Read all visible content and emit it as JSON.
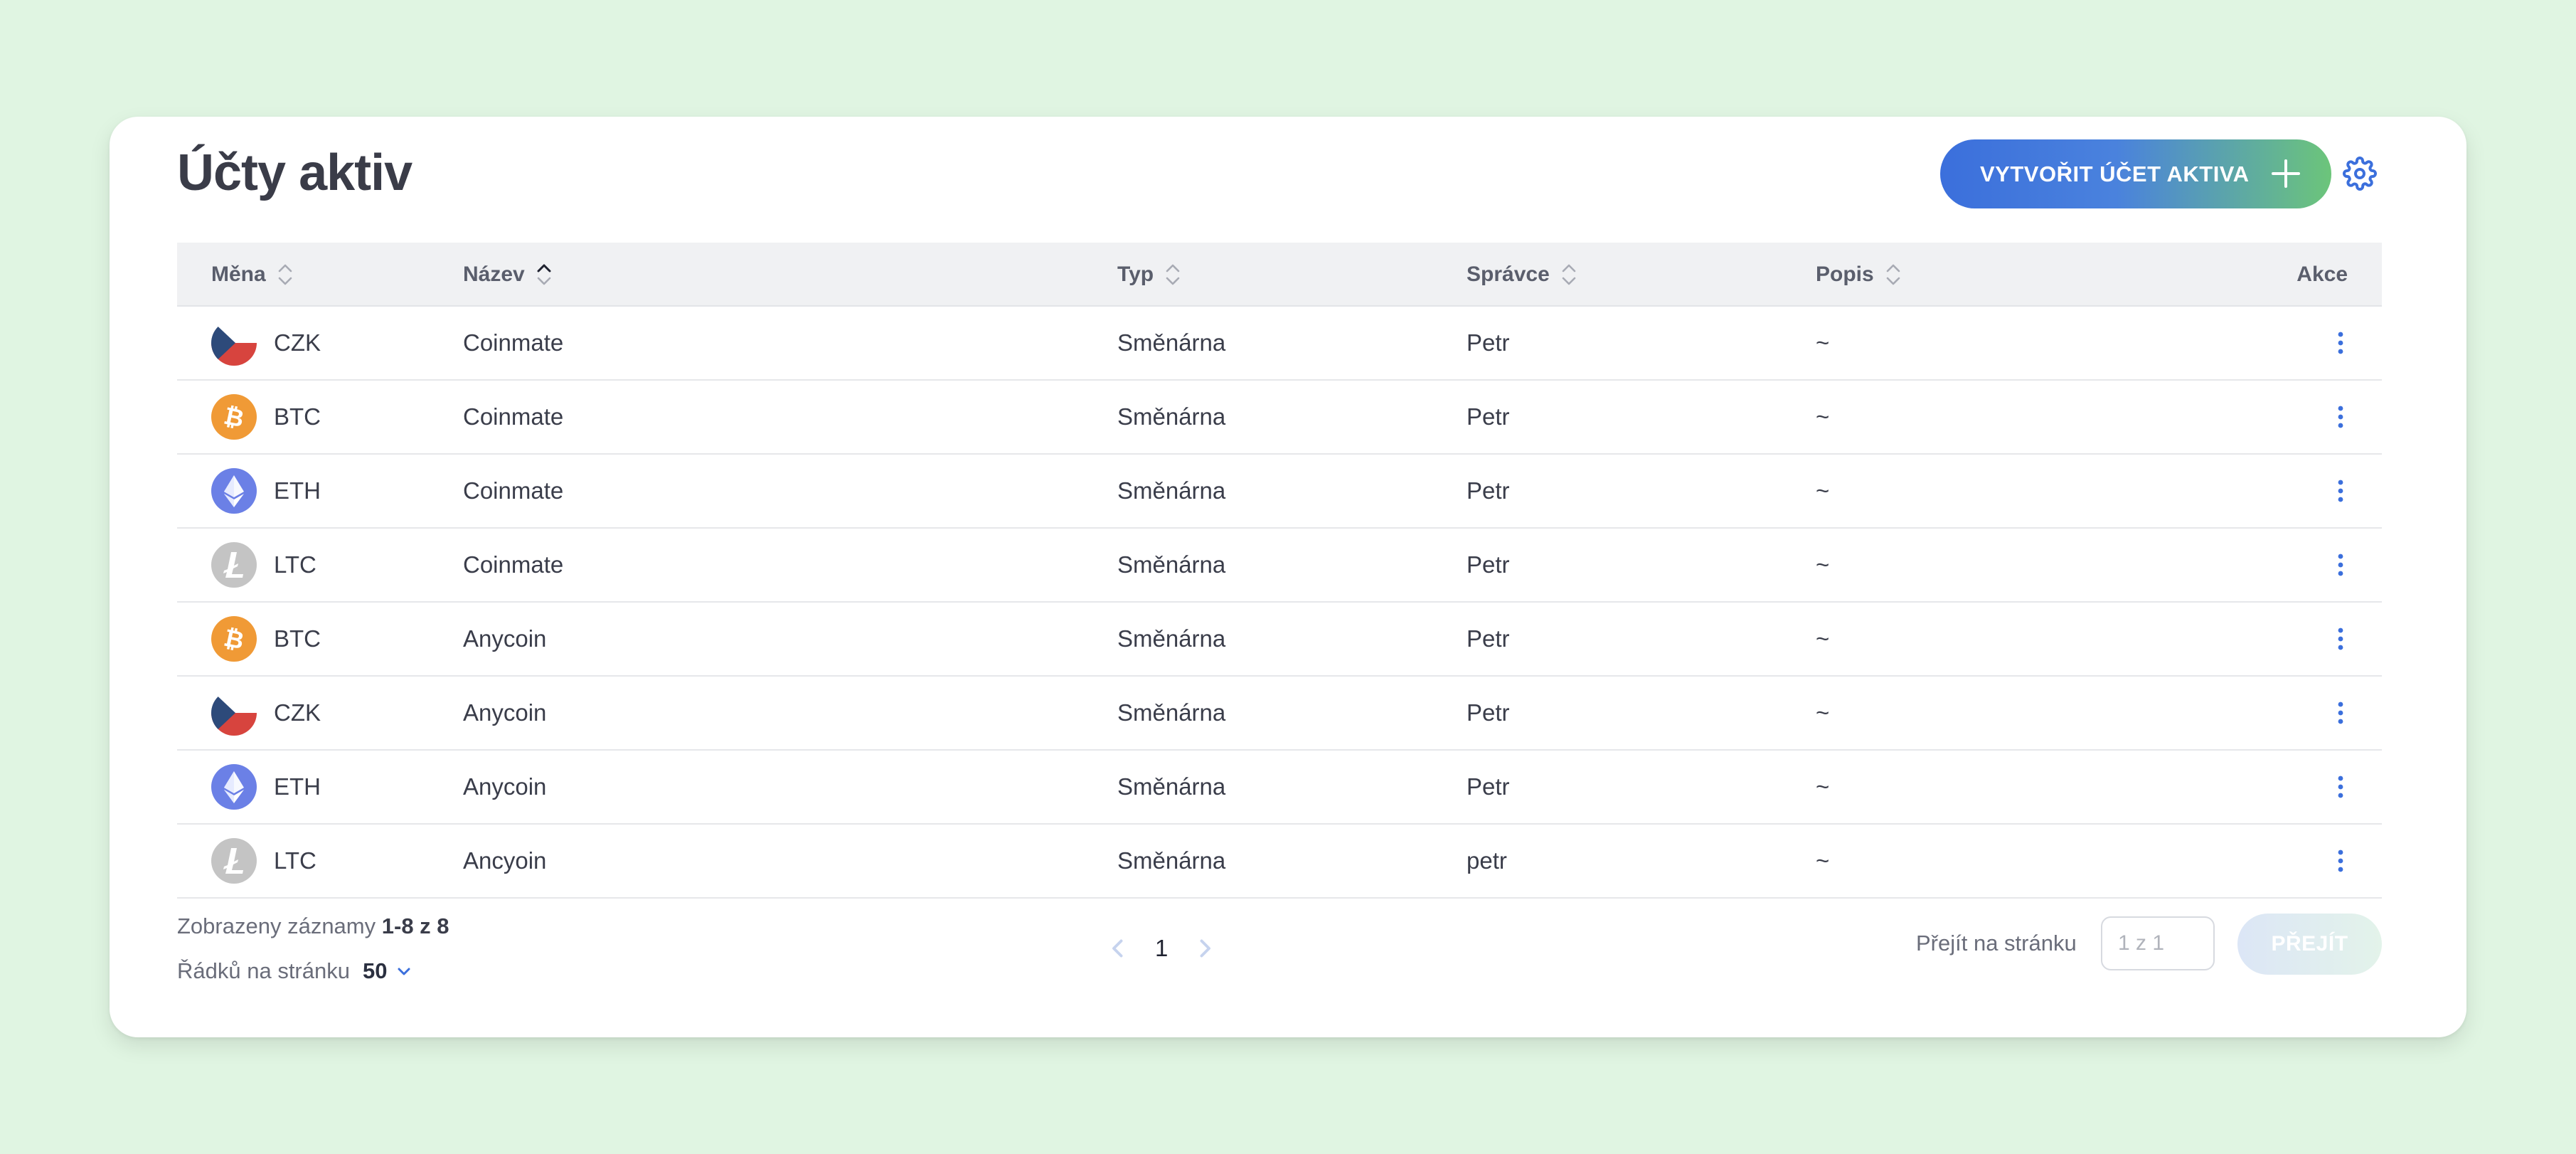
{
  "page": {
    "title": "Účty aktiv",
    "create_button": "VYTVOŘIT ÚČET AKTIVA"
  },
  "table": {
    "headers": {
      "currency": "Měna",
      "name": "Název",
      "type": "Typ",
      "manager": "Správce",
      "description": "Popis",
      "actions": "Akce"
    },
    "sorted_column": "name",
    "rows": [
      {
        "icon": "czk-flag-icon",
        "currency": "CZK",
        "name": "Coinmate",
        "type": "Směnárna",
        "manager": "Petr",
        "description": "~"
      },
      {
        "icon": "bitcoin-icon",
        "currency": "BTC",
        "name": "Coinmate",
        "type": "Směnárna",
        "manager": "Petr",
        "description": "~"
      },
      {
        "icon": "ethereum-icon",
        "currency": "ETH",
        "name": "Coinmate",
        "type": "Směnárna",
        "manager": "Petr",
        "description": "~"
      },
      {
        "icon": "litecoin-icon",
        "currency": "LTC",
        "name": "Coinmate",
        "type": "Směnárna",
        "manager": "Petr",
        "description": "~"
      },
      {
        "icon": "bitcoin-icon",
        "currency": "BTC",
        "name": "Anycoin",
        "type": "Směnárna",
        "manager": "Petr",
        "description": "~"
      },
      {
        "icon": "czk-flag-icon",
        "currency": "CZK",
        "name": "Anycoin",
        "type": "Směnárna",
        "manager": "Petr",
        "description": "~"
      },
      {
        "icon": "ethereum-icon",
        "currency": "ETH",
        "name": "Anycoin",
        "type": "Směnárna",
        "manager": "Petr",
        "description": "~"
      },
      {
        "icon": "litecoin-icon",
        "currency": "LTC",
        "name": "Ancyoin",
        "type": "Směnárna",
        "manager": "petr",
        "description": "~"
      }
    ]
  },
  "footer": {
    "records_prefix": "Zobrazeny záznamy",
    "records_range": "1-8 z 8",
    "rows_per_page_label": "Řádků na stránku",
    "rows_per_page_value": "50",
    "current_page": "1",
    "goto_label": "Přejít na stránku",
    "goto_placeholder": "1 z 1",
    "goto_button": "PŘEJÍT"
  },
  "colors": {
    "background": "#e0f5e2",
    "accent_blue": "#3b6fdc",
    "accent_green": "#6cc57a",
    "bitcoin": "#f09a36",
    "ethereum": "#6b80e6",
    "litecoin": "#c4c4c4"
  }
}
